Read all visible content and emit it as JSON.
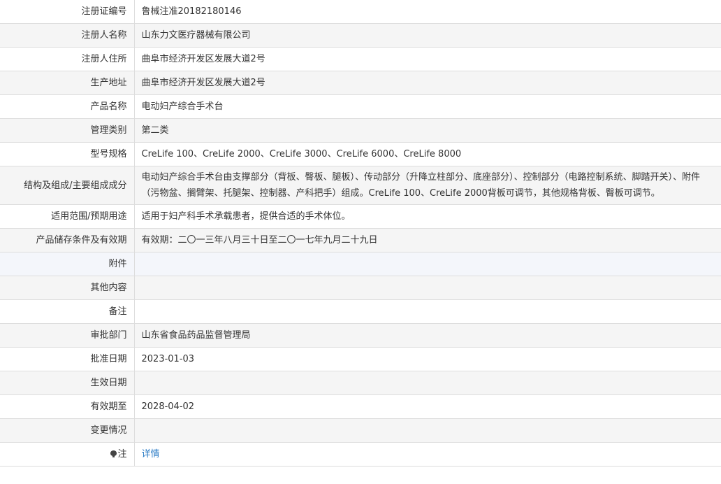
{
  "rows": [
    {
      "label": "注册证编号",
      "value": "鲁械注准20182180146"
    },
    {
      "label": "注册人名称",
      "value": "山东力文医疗器械有限公司"
    },
    {
      "label": "注册人住所",
      "value": "曲阜市经济开发区发展大道2号"
    },
    {
      "label": "生产地址",
      "value": "曲阜市经济开发区发展大道2号"
    },
    {
      "label": "产品名称",
      "value": "电动妇产综合手术台"
    },
    {
      "label": "管理类别",
      "value": "第二类"
    },
    {
      "label": "型号规格",
      "value": "CreLife 100、CreLife 2000、CreLife 3000、CreLife 6000、CreLife 8000"
    },
    {
      "label": "结构及组成/主要组成成分",
      "value": "电动妇产综合手术台由支撑部分（背板、臀板、腿板）、传动部分（升降立柱部分、底座部分）、控制部分（电路控制系统、脚踏开关）、附件（污物盆、搁臂架、托腿架、控制器、产科把手）组成。CreLife 100、CreLife 2000背板可调节，其他规格背板、臀板可调节。"
    },
    {
      "label": "适用范围/预期用途",
      "value": "适用于妇产科手术承载患者，提供合适的手术体位。"
    },
    {
      "label": "产品储存条件及有效期",
      "value": "有效期：二〇一三年八月三十日至二〇一七年九月二十九日"
    },
    {
      "label": "附件",
      "value": ""
    },
    {
      "label": "其他内容",
      "value": ""
    },
    {
      "label": "备注",
      "value": ""
    },
    {
      "label": "审批部门",
      "value": "山东省食品药品监督管理局"
    },
    {
      "label": "批准日期",
      "value": "2023-01-03"
    },
    {
      "label": "生效日期",
      "value": ""
    },
    {
      "label": "有效期至",
      "value": "2028-04-02"
    },
    {
      "label": "变更情况",
      "value": ""
    }
  ],
  "note": {
    "label": "注",
    "icon": "bulb-icon",
    "link_text": "详情",
    "link_color": "#2a7bc5"
  }
}
